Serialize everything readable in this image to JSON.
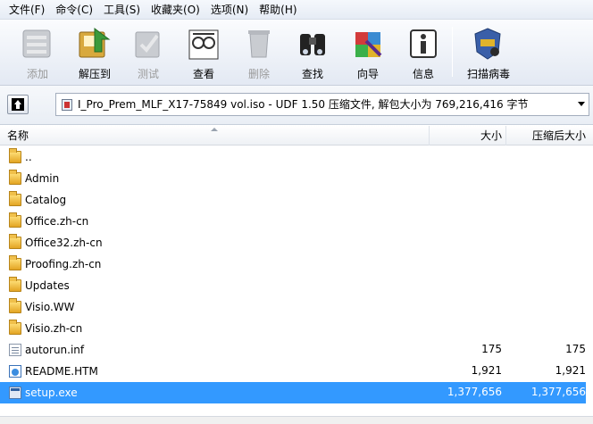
{
  "menu": [
    "文件(F)",
    "命令(C)",
    "工具(S)",
    "收藏夹(O)",
    "选项(N)",
    "帮助(H)"
  ],
  "toolbar": {
    "add": "添加",
    "extract": "解压到",
    "test": "测试",
    "view": "查看",
    "delete": "删除",
    "find": "查找",
    "wizard": "向导",
    "info": "信息",
    "scan": "扫描病毒"
  },
  "address": {
    "path": "I_Pro_Prem_MLF_X17-75849 vol.iso - UDF 1.50 压缩文件, 解包大小为 769,216,416 字节"
  },
  "columns": {
    "name": "名称",
    "size": "大小",
    "packed": "压缩后大小"
  },
  "files": [
    {
      "name": "..",
      "type": "folder",
      "size": "",
      "packed": ""
    },
    {
      "name": "Admin",
      "type": "folder",
      "size": "",
      "packed": ""
    },
    {
      "name": "Catalog",
      "type": "folder",
      "size": "",
      "packed": ""
    },
    {
      "name": "Office.zh-cn",
      "type": "folder",
      "size": "",
      "packed": ""
    },
    {
      "name": "Office32.zh-cn",
      "type": "folder",
      "size": "",
      "packed": ""
    },
    {
      "name": "Proofing.zh-cn",
      "type": "folder",
      "size": "",
      "packed": ""
    },
    {
      "name": "Updates",
      "type": "folder",
      "size": "",
      "packed": ""
    },
    {
      "name": "Visio.WW",
      "type": "folder",
      "size": "",
      "packed": ""
    },
    {
      "name": "Visio.zh-cn",
      "type": "folder",
      "size": "",
      "packed": ""
    },
    {
      "name": "autorun.inf",
      "type": "file",
      "size": "175",
      "packed": "175"
    },
    {
      "name": "README.HTM",
      "type": "html",
      "size": "1,921",
      "packed": "1,921"
    },
    {
      "name": "setup.exe",
      "type": "exe",
      "size": "1,377,656",
      "packed": "1,377,656"
    }
  ],
  "selection": {
    "selected_file": "setup.exe",
    "highlight_color": "#3399ff"
  }
}
